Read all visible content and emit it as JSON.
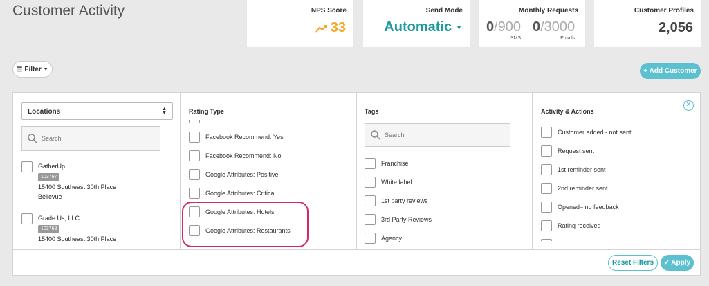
{
  "page": {
    "title": "Customer Activity"
  },
  "stats": {
    "nps": {
      "label": "NPS Score",
      "value": "33",
      "color": "#f5a623"
    },
    "send_mode": {
      "label": "Send Mode",
      "value": "Automatic",
      "color": "#1e9aa3"
    },
    "monthly_requests": {
      "label": "Monthly Requests",
      "sms": {
        "used": "0",
        "limit": "/900",
        "sub": "SMS"
      },
      "emails": {
        "used": "0",
        "limit": "/3000",
        "sub": "Emails"
      }
    },
    "profiles": {
      "label": "Customer Profiles",
      "value": "2,056"
    }
  },
  "toolbar": {
    "filter_label": "Filter",
    "add_customer_label": "+ Add Customer"
  },
  "filters": {
    "locations": {
      "select_value": "Locations",
      "search_placeholder": "Search",
      "items": [
        {
          "name": "GatherUp",
          "id": "103767",
          "address": "15400 Southeast 30th Place",
          "city": "Bellevue"
        },
        {
          "name": "Grade Us, LLC",
          "id": "103768",
          "address": "15400 Southeast 30th Place"
        }
      ]
    },
    "rating_type": {
      "title": "Rating Type",
      "options": [
        "Facebook Recommend: Yes",
        "Facebook Recommend: No",
        "Google Attributes: Positive",
        "Google Attributes: Critical",
        "Google Attributes: Hotels",
        "Google Attributes: Restaurants"
      ]
    },
    "tags": {
      "title": "Tags",
      "search_placeholder": "Search",
      "options": [
        "Franchise",
        "White label",
        "1st party reviews",
        "3rd Party Reviews",
        "Agency"
      ]
    },
    "activity": {
      "title": "Activity & Actions",
      "options": [
        "Customer added - not sent",
        "Request sent",
        "1st reminder sent",
        "2nd reminder sent",
        "Opened– no feedback",
        "Rating received"
      ]
    }
  },
  "footer": {
    "reset_label": "Reset Filters",
    "apply_label": "Apply"
  },
  "colors": {
    "accent": "#5bc0cf",
    "highlight": "#d1286f"
  }
}
